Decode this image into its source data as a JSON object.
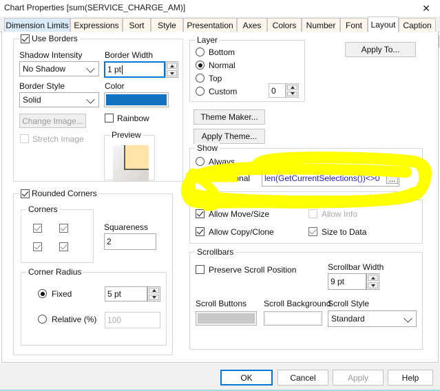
{
  "window": {
    "title": "Chart Properties [sum(SERVICE_CHARGE_AM)]",
    "close_icon": "close-icon"
  },
  "tabs": {
    "items": [
      {
        "label": "Dimension Limits",
        "state": "first"
      },
      {
        "label": "Expressions",
        "state": "normal"
      },
      {
        "label": "Sort",
        "state": "normal"
      },
      {
        "label": "Style",
        "state": "normal"
      },
      {
        "label": "Presentation",
        "state": "normal"
      },
      {
        "label": "Axes",
        "state": "normal"
      },
      {
        "label": "Colors",
        "state": "normal"
      },
      {
        "label": "Number",
        "state": "normal"
      },
      {
        "label": "Font",
        "state": "normal"
      },
      {
        "label": "Layout",
        "state": "active"
      },
      {
        "label": "Caption",
        "state": "normal"
      }
    ],
    "nav_prev": "◄",
    "nav_next": "►"
  },
  "borders": {
    "group_label": "Use Borders",
    "use_borders_checked": true,
    "shadow_intensity_label": "Shadow Intensity",
    "shadow_intensity_value": "No Shadow",
    "border_style_label": "Border Style",
    "border_style_value": "Solid",
    "change_image_label": "Change Image...",
    "stretch_image_label": "Stretch Image",
    "stretch_image_checked": false,
    "border_width_label": "Border Width",
    "border_width_value": "1 pt",
    "color_label": "Color",
    "color_value": "#1172c4",
    "rainbow_label": "Rainbow",
    "rainbow_checked": false,
    "preview_label": "Preview"
  },
  "rounded": {
    "group_label": "Rounded Corners",
    "rounded_checked": true,
    "corners_label": "Corners",
    "corner_tl_checked": true,
    "corner_tr_checked": true,
    "corner_bl_checked": true,
    "corner_br_checked": true,
    "squareness_label": "Squareness",
    "squareness_value": "2",
    "corner_radius_label": "Corner Radius",
    "fixed_label": "Fixed",
    "fixed_selected": true,
    "fixed_value": "5 pt",
    "relative_label": "Relative (%)",
    "relative_selected": false,
    "relative_value": "100"
  },
  "layer": {
    "group_label": "Layer",
    "options": [
      "Bottom",
      "Normal",
      "Top",
      "Custom"
    ],
    "selected": "Normal",
    "custom_value": "0"
  },
  "theme": {
    "theme_maker_label": "Theme Maker...",
    "apply_theme_label": "Apply Theme..."
  },
  "apply_to": {
    "label": "Apply To..."
  },
  "show": {
    "group_label": "Show",
    "always_label": "Always",
    "conditional_label": "Conditional",
    "selected": "Conditional",
    "expression_value": "len(GetCurrentSelections())<>0",
    "expression_color": "#1b1bd0",
    "ellipsis_label": "..."
  },
  "options": {
    "group_label": "Options",
    "allow_move_size_label": "Allow Move/Size",
    "allow_move_size_checked": true,
    "allow_copy_clone_label": "Allow Copy/Clone",
    "allow_copy_clone_checked": true,
    "allow_info_label": "Allow Info",
    "allow_info_checked": false,
    "allow_info_disabled": true,
    "size_to_data_label": "Size to Data",
    "size_to_data_checked": true
  },
  "scrollbars": {
    "group_label": "Scrollbars",
    "preserve_scroll_label": "Preserve Scroll Position",
    "preserve_scroll_checked": false,
    "scrollbar_width_label": "Scrollbar Width",
    "scrollbar_width_value": "9 pt",
    "scroll_buttons_label": "Scroll Buttons",
    "scroll_buttons_color": "#c8c8c8",
    "scroll_background_label": "Scroll Background",
    "scroll_background_color": "#ffffff",
    "scroll_style_label": "Scroll Style",
    "scroll_style_value": "Standard"
  },
  "footer": {
    "ok_label": "OK",
    "cancel_label": "Cancel",
    "apply_label": "Apply",
    "help_label": "Help"
  },
  "annotation": {
    "highlighter_color": "#ffff00",
    "shape": "hand-drawn-oval"
  }
}
